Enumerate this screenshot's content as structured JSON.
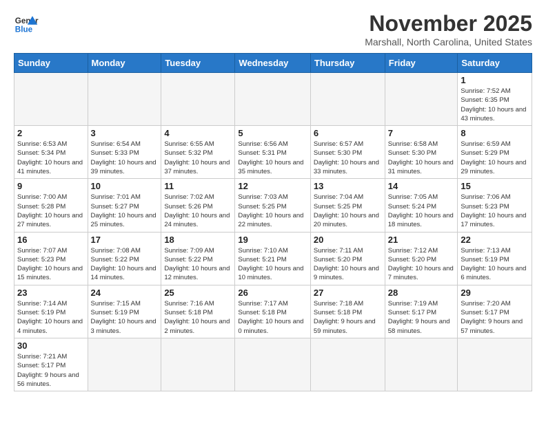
{
  "header": {
    "logo_general": "General",
    "logo_blue": "Blue",
    "month_title": "November 2025",
    "subtitle": "Marshall, North Carolina, United States"
  },
  "days_of_week": [
    "Sunday",
    "Monday",
    "Tuesday",
    "Wednesday",
    "Thursday",
    "Friday",
    "Saturday"
  ],
  "weeks": [
    [
      {
        "day": "",
        "info": ""
      },
      {
        "day": "",
        "info": ""
      },
      {
        "day": "",
        "info": ""
      },
      {
        "day": "",
        "info": ""
      },
      {
        "day": "",
        "info": ""
      },
      {
        "day": "",
        "info": ""
      },
      {
        "day": "1",
        "info": "Sunrise: 7:52 AM\nSunset: 6:35 PM\nDaylight: 10 hours and 43 minutes."
      }
    ],
    [
      {
        "day": "2",
        "info": "Sunrise: 6:53 AM\nSunset: 5:34 PM\nDaylight: 10 hours and 41 minutes."
      },
      {
        "day": "3",
        "info": "Sunrise: 6:54 AM\nSunset: 5:33 PM\nDaylight: 10 hours and 39 minutes."
      },
      {
        "day": "4",
        "info": "Sunrise: 6:55 AM\nSunset: 5:32 PM\nDaylight: 10 hours and 37 minutes."
      },
      {
        "day": "5",
        "info": "Sunrise: 6:56 AM\nSunset: 5:31 PM\nDaylight: 10 hours and 35 minutes."
      },
      {
        "day": "6",
        "info": "Sunrise: 6:57 AM\nSunset: 5:30 PM\nDaylight: 10 hours and 33 minutes."
      },
      {
        "day": "7",
        "info": "Sunrise: 6:58 AM\nSunset: 5:30 PM\nDaylight: 10 hours and 31 minutes."
      },
      {
        "day": "8",
        "info": "Sunrise: 6:59 AM\nSunset: 5:29 PM\nDaylight: 10 hours and 29 minutes."
      }
    ],
    [
      {
        "day": "9",
        "info": "Sunrise: 7:00 AM\nSunset: 5:28 PM\nDaylight: 10 hours and 27 minutes."
      },
      {
        "day": "10",
        "info": "Sunrise: 7:01 AM\nSunset: 5:27 PM\nDaylight: 10 hours and 25 minutes."
      },
      {
        "day": "11",
        "info": "Sunrise: 7:02 AM\nSunset: 5:26 PM\nDaylight: 10 hours and 24 minutes."
      },
      {
        "day": "12",
        "info": "Sunrise: 7:03 AM\nSunset: 5:25 PM\nDaylight: 10 hours and 22 minutes."
      },
      {
        "day": "13",
        "info": "Sunrise: 7:04 AM\nSunset: 5:25 PM\nDaylight: 10 hours and 20 minutes."
      },
      {
        "day": "14",
        "info": "Sunrise: 7:05 AM\nSunset: 5:24 PM\nDaylight: 10 hours and 18 minutes."
      },
      {
        "day": "15",
        "info": "Sunrise: 7:06 AM\nSunset: 5:23 PM\nDaylight: 10 hours and 17 minutes."
      }
    ],
    [
      {
        "day": "16",
        "info": "Sunrise: 7:07 AM\nSunset: 5:23 PM\nDaylight: 10 hours and 15 minutes."
      },
      {
        "day": "17",
        "info": "Sunrise: 7:08 AM\nSunset: 5:22 PM\nDaylight: 10 hours and 14 minutes."
      },
      {
        "day": "18",
        "info": "Sunrise: 7:09 AM\nSunset: 5:22 PM\nDaylight: 10 hours and 12 minutes."
      },
      {
        "day": "19",
        "info": "Sunrise: 7:10 AM\nSunset: 5:21 PM\nDaylight: 10 hours and 10 minutes."
      },
      {
        "day": "20",
        "info": "Sunrise: 7:11 AM\nSunset: 5:20 PM\nDaylight: 10 hours and 9 minutes."
      },
      {
        "day": "21",
        "info": "Sunrise: 7:12 AM\nSunset: 5:20 PM\nDaylight: 10 hours and 7 minutes."
      },
      {
        "day": "22",
        "info": "Sunrise: 7:13 AM\nSunset: 5:19 PM\nDaylight: 10 hours and 6 minutes."
      }
    ],
    [
      {
        "day": "23",
        "info": "Sunrise: 7:14 AM\nSunset: 5:19 PM\nDaylight: 10 hours and 4 minutes."
      },
      {
        "day": "24",
        "info": "Sunrise: 7:15 AM\nSunset: 5:19 PM\nDaylight: 10 hours and 3 minutes."
      },
      {
        "day": "25",
        "info": "Sunrise: 7:16 AM\nSunset: 5:18 PM\nDaylight: 10 hours and 2 minutes."
      },
      {
        "day": "26",
        "info": "Sunrise: 7:17 AM\nSunset: 5:18 PM\nDaylight: 10 hours and 0 minutes."
      },
      {
        "day": "27",
        "info": "Sunrise: 7:18 AM\nSunset: 5:18 PM\nDaylight: 9 hours and 59 minutes."
      },
      {
        "day": "28",
        "info": "Sunrise: 7:19 AM\nSunset: 5:17 PM\nDaylight: 9 hours and 58 minutes."
      },
      {
        "day": "29",
        "info": "Sunrise: 7:20 AM\nSunset: 5:17 PM\nDaylight: 9 hours and 57 minutes."
      }
    ],
    [
      {
        "day": "30",
        "info": "Sunrise: 7:21 AM\nSunset: 5:17 PM\nDaylight: 9 hours and 56 minutes."
      },
      {
        "day": "",
        "info": ""
      },
      {
        "day": "",
        "info": ""
      },
      {
        "day": "",
        "info": ""
      },
      {
        "day": "",
        "info": ""
      },
      {
        "day": "",
        "info": ""
      },
      {
        "day": "",
        "info": ""
      }
    ]
  ]
}
